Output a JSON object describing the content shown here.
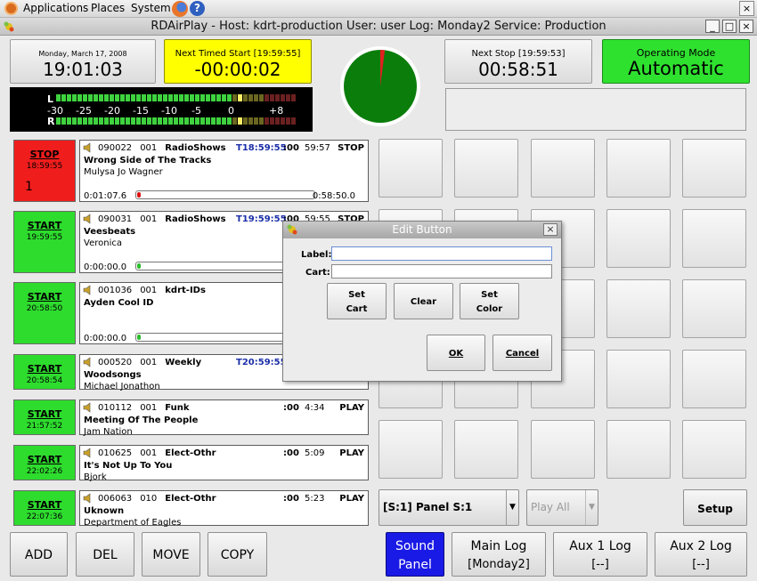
{
  "gnome_panel": {
    "menus": [
      "Applications",
      "Places",
      "System"
    ],
    "close_glyph": "×"
  },
  "window": {
    "title": "RDAirPlay - Host: kdrt-production  User: user  Log: Monday2  Service: Production",
    "buttons": [
      "_",
      "□",
      "×"
    ]
  },
  "header": {
    "date": "Monday, March 17, 2008",
    "time": "19:01:03",
    "next_timed_label": "Next Timed Start [19:59:55]",
    "next_timed_value": "-00:00:02",
    "next_stop_label": "Next Stop [19:59:53]",
    "next_stop_value": "00:58:51",
    "op_mode_label": "Operating Mode",
    "op_mode_value": "Automatic",
    "pie_progress_fraction": 0.02
  },
  "meter": {
    "left_label": "L",
    "right_label": "R",
    "scale": [
      "-30",
      "-25",
      "-20",
      "-15",
      "-10",
      "-5",
      "0",
      "+8"
    ]
  },
  "log": [
    {
      "button": "STOP",
      "button_time": "18:59:55",
      "button_number": "1",
      "state": "stop",
      "cart": "090022",
      "cut": "001",
      "group": "RadioShows",
      "start": "T18:59:55",
      "trans": ":00",
      "length": "59:57",
      "action": "STOP",
      "title": "Wrong Side of The Tracks",
      "artist": "Mulysa Jo Wagner",
      "pos": "0:01:07.6",
      "remaining": "0:58:50.0",
      "bar_color": "#d11"
    },
    {
      "button": "START",
      "button_time": "19:59:55",
      "state": "start",
      "cart": "090031",
      "cut": "001",
      "group": "RadioShows",
      "start": "T19:59:55",
      "trans": ":00",
      "length": "59:55",
      "action": "STOP",
      "title": "Veesbeats",
      "artist": "Veronica",
      "pos": "0:00:00.0",
      "remaining": "",
      "bar_color": "#2dbd2d"
    },
    {
      "button": "START",
      "button_time": "20:58:50",
      "state": "start",
      "cart": "001036",
      "cut": "001",
      "group": "kdrt-IDs",
      "start": "",
      "trans": "",
      "length": "",
      "action": "",
      "title": "Ayden Cool ID",
      "artist": "",
      "pos": "0:00:00.0",
      "remaining": "",
      "bar_color": "#2dbd2d"
    },
    {
      "button": "START",
      "button_time": "20:58:54",
      "state": "start",
      "cart": "000520",
      "cut": "001",
      "group": "Weekly",
      "start": "T20:59:55",
      "trans": "",
      "length": "",
      "action": "",
      "title": "Woodsongs",
      "artist": "Michael Jonathon"
    },
    {
      "button": "START",
      "button_time": "21:57:52",
      "state": "start",
      "cart": "010112",
      "cut": "001",
      "group": "Funk",
      "start": "",
      "trans": ":00",
      "length": "4:34",
      "action": "PLAY",
      "title": "Meeting Of The People",
      "artist": "Jam Nation"
    },
    {
      "button": "START",
      "button_time": "22:02:26",
      "state": "start",
      "cart": "010625",
      "cut": "001",
      "group": "Elect-Othr",
      "start": "",
      "trans": ":00",
      "length": "5:09",
      "action": "PLAY",
      "title": "It's Not Up To You",
      "artist": "Bjork"
    },
    {
      "button": "START",
      "button_time": "22:07:36",
      "state": "start",
      "cart": "006063",
      "cut": "010",
      "group": "Elect-Othr",
      "start": "",
      "trans": ":00",
      "length": "5:23",
      "action": "PLAY",
      "title": "Uknown",
      "artist": "Department of Eagles"
    }
  ],
  "panel": {
    "selector": "[S:1] Panel S:1",
    "play_all": "Play All",
    "setup": "Setup"
  },
  "bottom": {
    "add": "ADD",
    "del": "DEL",
    "move": "MOVE",
    "copy": "COPY",
    "sound_panel_1": "Sound",
    "sound_panel_2": "Panel",
    "main_log_1": "Main Log",
    "main_log_2": "[Monday2]",
    "aux1_1": "Aux 1 Log",
    "aux1_2": "[--]",
    "aux2_1": "Aux 2 Log",
    "aux2_2": "[--]"
  },
  "dialog": {
    "title": "Edit Button",
    "close_glyph": "×",
    "label_caption": "Label:",
    "cart_caption": "Cart:",
    "label_value": "",
    "cart_value": "",
    "set_cart_1": "Set",
    "set_cart_2": "Cart",
    "clear": "Clear",
    "set_color_1": "Set",
    "set_color_2": "Color",
    "ok": "OK",
    "cancel": "Cancel"
  },
  "colors": {
    "next_timed_bg": "#ffff00",
    "op_mode_bg": "#2fe12f",
    "stop_bg": "#f01d1d",
    "start_bg": "#2edc2e",
    "pie_green": "#0b7d0b",
    "sound_panel_bg": "#1a1ae6",
    "time_blue": "#1c2fa8"
  }
}
